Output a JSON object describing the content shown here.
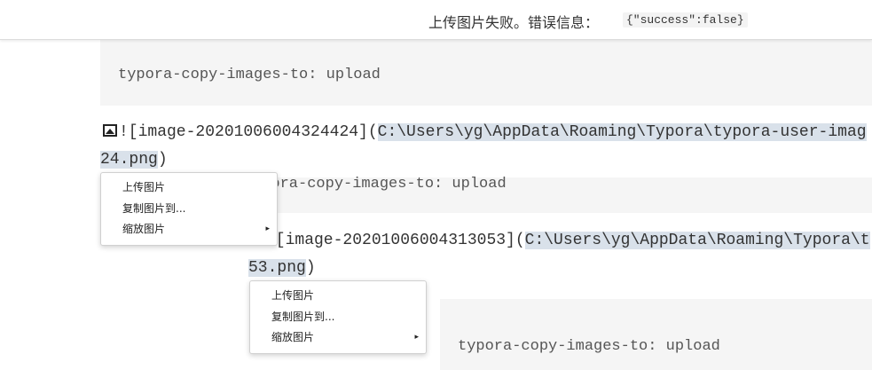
{
  "notification": {
    "message": "上传图片失败。错误信息：",
    "error_code": "{\"success\":false}"
  },
  "code_blocks": [
    {
      "text": "typora-copy-images-to: upload"
    },
    {
      "text": "ypora-copy-images-to: upload"
    },
    {
      "text": "typora-copy-images-to: upload"
    }
  ],
  "image_lines": [
    {
      "alt": "![image-20201006004324424](",
      "path_visible": "C:\\Users\\yg\\AppData\\Roaming\\Typora\\typora-user-imag",
      "path_tail": "24.png",
      "close": ")"
    },
    {
      "alt": "![image-20201006004313053](",
      "path_visible": "C:\\Users\\yg\\AppData\\Roaming\\Typora\\t",
      "path_tail": "53.png",
      "close": ")"
    }
  ],
  "context_menu": {
    "items": [
      {
        "label": "上传图片"
      },
      {
        "label": "复制图片到..."
      },
      {
        "label": "缩放图片",
        "submenu_arrow": "▸"
      }
    ]
  }
}
